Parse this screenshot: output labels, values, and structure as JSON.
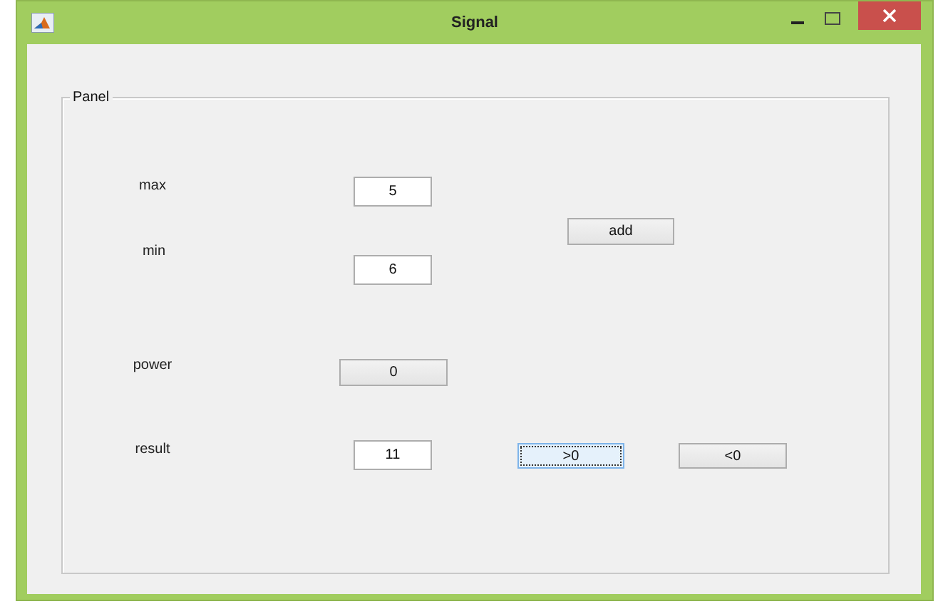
{
  "window": {
    "title": "Signal"
  },
  "panel": {
    "title": "Panel",
    "controls": [
      {
        "kind": "label",
        "text": "max"
      },
      {
        "kind": "field",
        "value": "5"
      },
      {
        "kind": "button",
        "text": "add",
        "focused": false
      },
      {
        "kind": "label",
        "text": "min"
      },
      {
        "kind": "field",
        "value": "6"
      },
      {
        "kind": "label",
        "text": "power"
      },
      {
        "kind": "button",
        "text": "0",
        "focused": false
      },
      {
        "kind": "label",
        "text": "result"
      },
      {
        "kind": "field",
        "value": "11"
      },
      {
        "kind": "button",
        "text": ">0",
        "focused": true
      },
      {
        "kind": "button",
        "text": "<0",
        "focused": false
      }
    ]
  }
}
